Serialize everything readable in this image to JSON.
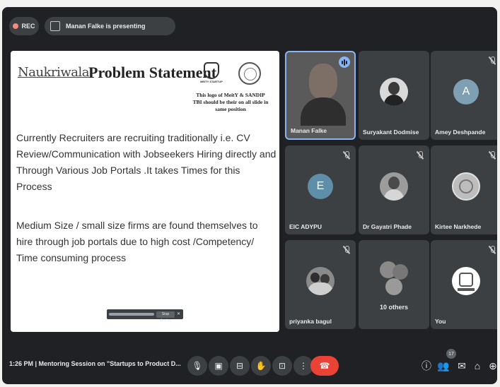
{
  "top_bar": {
    "rec_label": "REC",
    "presenting_text": "Manan Falke is presenting"
  },
  "slide": {
    "logo_text": "Naukriwala",
    "title": "Problem Statement",
    "logo_meity_text": "MEITY STARTUP",
    "logo_note": "This logo of MeitY & SANDIP TBI should be their on all slide in same position",
    "paragraph1": "Currently Recruiters are recruiting traditionally i.e. CV Review/Communication with Jobseekers Hiring directly and Through Various Job Portals .It takes Times for this Process",
    "paragraph2": "Medium Size / small size firms are found themselves to hire through job portals due to high cost /Competency/ Time consuming process",
    "toolbar_button": "Stop sharing"
  },
  "participants": [
    {
      "name": "Manan Falke",
      "type": "video"
    },
    {
      "name": "Suryakant Dodmise",
      "type": "photo"
    },
    {
      "name": "Amey Deshpande",
      "type": "initial",
      "initial": "A",
      "color": "#7f9fb3"
    },
    {
      "name": "EIC ADYPU",
      "type": "initial",
      "initial": "E",
      "color": "#5f8fa8"
    },
    {
      "name": "Dr Gayatri Phade",
      "type": "photo"
    },
    {
      "name": "Kirtee Narkhede",
      "type": "photo"
    },
    {
      "name": "priyanka bagul",
      "type": "photo"
    },
    {
      "name": "10 others",
      "type": "group"
    },
    {
      "name": "You",
      "type": "photo"
    }
  ],
  "bottom_bar": {
    "meeting_info": "1:26 PM  |  Mentoring Session on \"Startups to Product D...",
    "participant_count": "17"
  },
  "colors": {
    "background": "#202124",
    "tile": "#3c4043",
    "accent": "#8ab4f8",
    "leave": "#ea4335"
  }
}
